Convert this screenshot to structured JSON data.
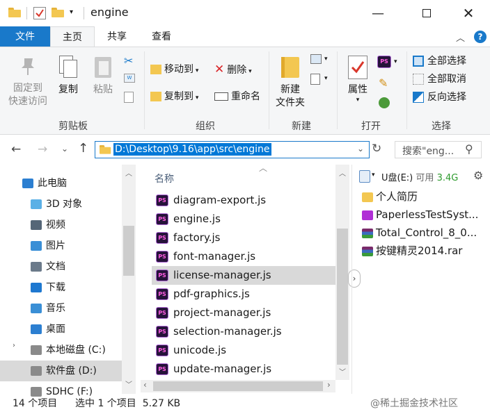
{
  "window": {
    "title": "engine"
  },
  "tabs": [
    "文件",
    "主页",
    "共享",
    "查看"
  ],
  "ribbon": {
    "clipboard": {
      "label": "剪贴板",
      "pin_line1": "固定到",
      "pin_line2": "快速访问",
      "copy": "复制",
      "paste": "粘贴"
    },
    "organize": {
      "label": "组织",
      "move_to": "移动到",
      "copy_to": "复制到",
      "delete": "删除",
      "rename": "重命名"
    },
    "new": {
      "label": "新建",
      "new_folder_line1": "新建",
      "new_folder_line2": "文件夹"
    },
    "open": {
      "label": "打开",
      "properties": "属性"
    },
    "select": {
      "label": "选择",
      "select_all": "全部选择",
      "select_none": "全部取消",
      "invert": "反向选择"
    }
  },
  "address": {
    "path": "D:\\Desktop\\9.16\\app\\src\\engine"
  },
  "search": {
    "placeholder": "搜索\"eng..."
  },
  "nav": {
    "items": [
      {
        "label": "此电脑",
        "icon": "computer-icon"
      },
      {
        "label": "3D 对象",
        "icon": "3d-objects-icon"
      },
      {
        "label": "视频",
        "icon": "video-icon"
      },
      {
        "label": "图片",
        "icon": "pictures-icon"
      },
      {
        "label": "文档",
        "icon": "documents-icon"
      },
      {
        "label": "下载",
        "icon": "downloads-icon"
      },
      {
        "label": "音乐",
        "icon": "music-icon"
      },
      {
        "label": "桌面",
        "icon": "desktop-icon"
      },
      {
        "label": "本地磁盘 (C:)",
        "icon": "drive-icon"
      },
      {
        "label": "软件盘 (D:)",
        "icon": "drive-icon"
      },
      {
        "label": "SDHC (F:)",
        "icon": "sd-card-icon"
      }
    ]
  },
  "list": {
    "column_name": "名称",
    "files": [
      "diagram-export.js",
      "engine.js",
      "factory.js",
      "font-manager.js",
      "license-manager.js",
      "pdf-graphics.js",
      "project-manager.js",
      "selection-manager.js",
      "unicode.js",
      "update-manager.js"
    ],
    "selected_index": 4
  },
  "preview": {
    "drive_label": "U盘(E:)",
    "available_label": "可用",
    "available_value": "3.4G",
    "items": [
      {
        "name": "个人简历",
        "icon": "folder-icon"
      },
      {
        "name": "PaperlessTestSyst...",
        "icon": "app-icon"
      },
      {
        "name": "Total_Control_8_0...",
        "icon": "archive-icon"
      },
      {
        "name": "按键精灵2014.rar",
        "icon": "archive-icon"
      }
    ]
  },
  "status": {
    "count": "14 个项目",
    "selection": "选中 1 个项目  5.27 KB"
  },
  "watermark": "@稀土掘金技术社区",
  "colors": {
    "accent": "#1979ca",
    "selection": "#d9d9d9",
    "ps_icon": "#26133a"
  }
}
